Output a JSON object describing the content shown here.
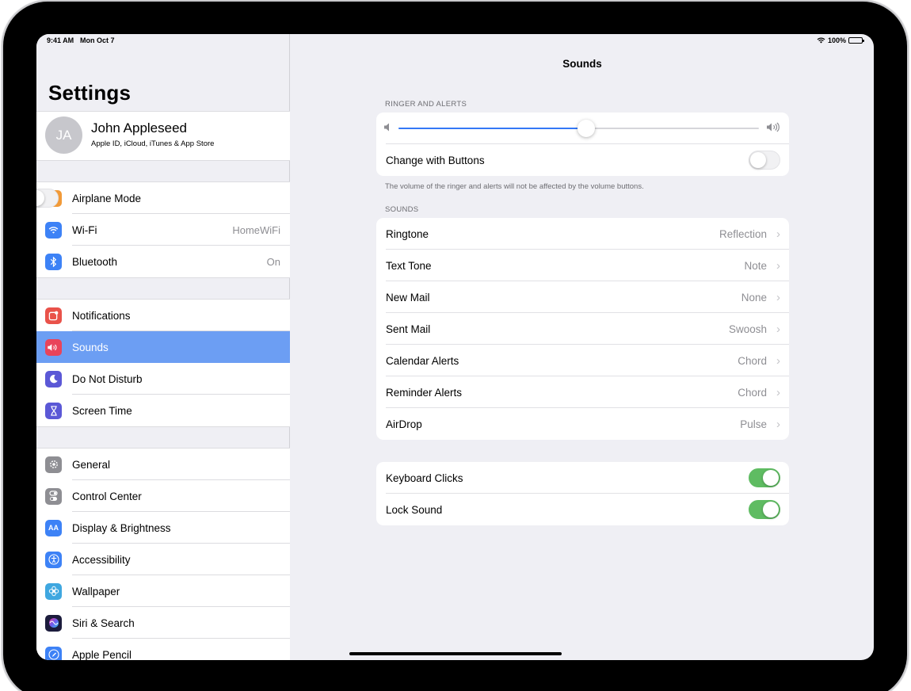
{
  "status": {
    "time": "9:41 AM",
    "date": "Mon Oct 7",
    "battery": "100%"
  },
  "sidebar": {
    "title": "Settings",
    "profile": {
      "initials": "JA",
      "name": "John Appleseed",
      "subtitle": "Apple ID, iCloud, iTunes & App Store"
    },
    "groups": [
      [
        {
          "label": "Airplane Mode",
          "icon": "airplane-icon",
          "color": "#f19a38",
          "toggle": false
        },
        {
          "label": "Wi-Fi",
          "icon": "wifi-icon",
          "color": "#3d82f6",
          "value": "HomeWiFi"
        },
        {
          "label": "Bluetooth",
          "icon": "bluetooth-icon",
          "color": "#3d82f6",
          "value": "On"
        }
      ],
      [
        {
          "label": "Notifications",
          "icon": "notifications-icon",
          "color": "#e9524a"
        },
        {
          "label": "Sounds",
          "icon": "speaker-icon",
          "color": "#e9445a",
          "selected": true
        },
        {
          "label": "Do Not Disturb",
          "icon": "moon-icon",
          "color": "#5b58d6"
        },
        {
          "label": "Screen Time",
          "icon": "hourglass-icon",
          "color": "#5b58d6"
        }
      ],
      [
        {
          "label": "General",
          "icon": "gear-icon",
          "color": "#8e8e93"
        },
        {
          "label": "Control Center",
          "icon": "switches-icon",
          "color": "#8e8e93"
        },
        {
          "label": "Display & Brightness",
          "icon": "aa-icon",
          "color": "#3d82f6"
        },
        {
          "label": "Accessibility",
          "icon": "accessibility-icon",
          "color": "#3d82f6"
        },
        {
          "label": "Wallpaper",
          "icon": "flower-icon",
          "color": "#3fa7e0"
        },
        {
          "label": "Siri & Search",
          "icon": "siri-icon",
          "color": "#1c1c3c"
        },
        {
          "label": "Apple Pencil",
          "icon": "pencil-icon",
          "color": "#3d82f6"
        }
      ]
    ]
  },
  "main": {
    "title": "Sounds",
    "ringer_header": "RINGER AND ALERTS",
    "volume_level": 0.52,
    "change_with_buttons": {
      "label": "Change with Buttons",
      "on": false
    },
    "ringer_footer": "The volume of the ringer and alerts will not be affected by the volume buttons.",
    "sounds_header": "SOUNDS",
    "sounds": [
      {
        "label": "Ringtone",
        "value": "Reflection"
      },
      {
        "label": "Text Tone",
        "value": "Note"
      },
      {
        "label": "New Mail",
        "value": "None"
      },
      {
        "label": "Sent Mail",
        "value": "Swoosh"
      },
      {
        "label": "Calendar Alerts",
        "value": "Chord"
      },
      {
        "label": "Reminder Alerts",
        "value": "Chord"
      },
      {
        "label": "AirDrop",
        "value": "Pulse"
      }
    ],
    "toggles": [
      {
        "label": "Keyboard Clicks",
        "on": true
      },
      {
        "label": "Lock Sound",
        "on": true
      }
    ]
  }
}
